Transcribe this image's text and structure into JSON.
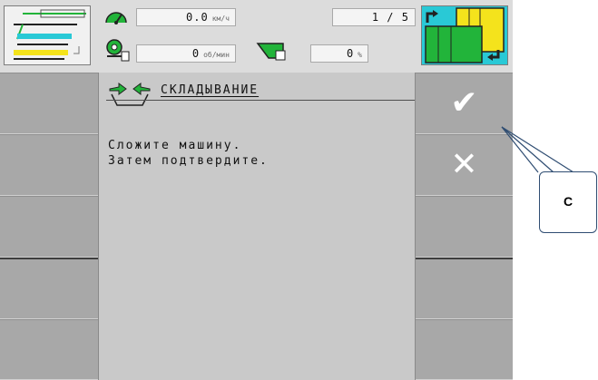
{
  "statusbar": {
    "speed_value": "0.0",
    "speed_unit": "км/ч",
    "rate_value": "0",
    "rate_unit": "об/мин",
    "percent_value": "0",
    "percent_unit": "%",
    "page_current": "1",
    "page_sep": "/",
    "page_total": "5"
  },
  "mask": {
    "title": "СКЛАДЫВАНИЕ",
    "body_line1": "Сложите машину.",
    "body_line2": "Затем подтвердите."
  },
  "softkeys": {
    "confirm_glyph": "✔",
    "cancel_glyph": "✕"
  },
  "annotation": {
    "label": "C"
  },
  "colors": {
    "softkey_bg": "#a8a8a8",
    "mask_bg": "#c9c9c9",
    "callout_border": "#2f4d72",
    "icon_green": "#22b43a",
    "icon_yellow": "#f4e31c",
    "icon_cyan": "#29c9d6"
  },
  "icons": [
    "machine-layout-icon",
    "speedometer-icon",
    "rpm-icon",
    "hopper-icon",
    "page-switch-icon",
    "fold-arrows-icon",
    "checkmark-icon",
    "cross-icon"
  ]
}
